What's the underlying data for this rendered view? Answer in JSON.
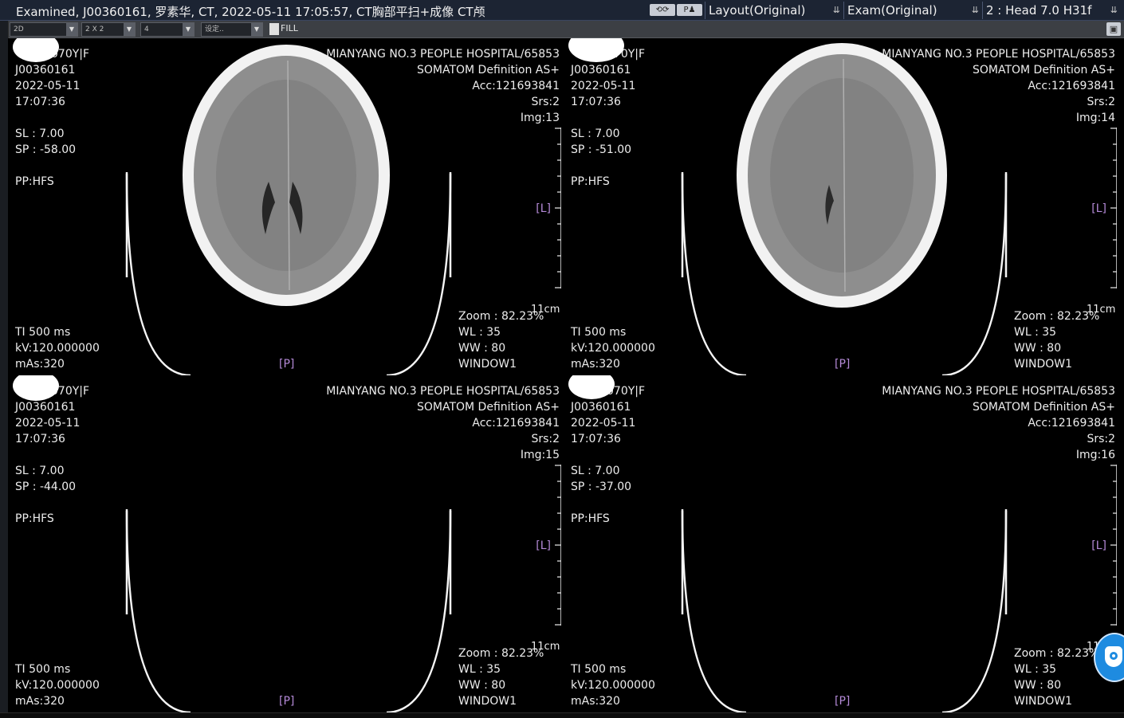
{
  "titlebar": {
    "title": "Examined, J00360161, 罗素华, CT, 2022-05-11 17:05:57, CT胸部平扫+成像 CT颅",
    "layout_dropdown": "Layout(Original)",
    "exam_dropdown": "Exam(Original)",
    "series_dropdown": "2 : Head  7.0  H31f"
  },
  "toolbar": {
    "mode_select": "2D",
    "grid_select": "2 X 2",
    "count_select": "4",
    "preset_select": "设定..",
    "fill_label": "FILL"
  },
  "common": {
    "hospital": "MIANYANG NO.3 PEOPLE HOSPITAL/65853",
    "scanner": "SOMATOM Definition AS+",
    "acc": "Acc:121693841",
    "srs": "Srs:2",
    "patient_suffix": "070Y|F",
    "patient_id": "J00360161",
    "date": "2022-05-11",
    "time": "17:07:36",
    "sl": "SL : 7.00",
    "pp": "PP:HFS",
    "ti": "TI 500 ms",
    "kv": "kV:120.000000",
    "mas": "mAs:320",
    "zoom": "Zoom : 82.23%",
    "wl": "WL : 35",
    "ww": "WW : 80",
    "window": "WINDOW1",
    "scale": "11cm",
    "left_marker": "[L]",
    "post_marker": "[P]"
  },
  "viewports": [
    {
      "img": "Img:13",
      "sp": "SP : -58.00"
    },
    {
      "img": "Img:14",
      "sp": "SP : -51.00"
    },
    {
      "img": "Img:15",
      "sp": "SP : -44.00"
    },
    {
      "img": "Img:16",
      "sp": "SP : -37.00"
    }
  ],
  "colors": {
    "accent_marker": "#b58ad8",
    "titlebar_bg": "#1c2433",
    "toolbar_bg": "#3c3f44"
  }
}
